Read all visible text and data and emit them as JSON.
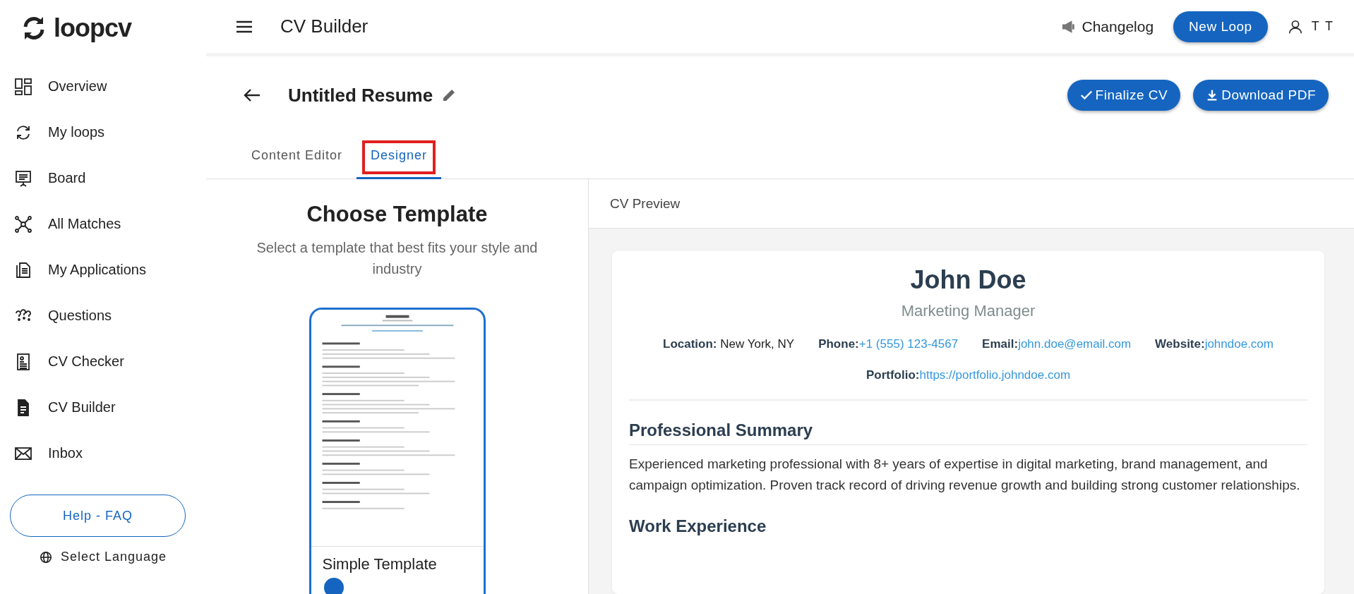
{
  "brand": {
    "name": "loopcv"
  },
  "sidebar": {
    "items": [
      {
        "label": "Overview",
        "selected": false
      },
      {
        "label": "My loops",
        "selected": false
      },
      {
        "label": "Board",
        "selected": false
      },
      {
        "label": "All Matches",
        "selected": false
      },
      {
        "label": "My Applications",
        "selected": false
      },
      {
        "label": "Questions",
        "selected": false
      },
      {
        "label": "CV Checker",
        "selected": false
      },
      {
        "label": "CV Builder",
        "selected": false
      },
      {
        "label": "Inbox",
        "selected": false
      }
    ],
    "help_button": "Help - FAQ",
    "language": "Select Language"
  },
  "topbar": {
    "title": "CV Builder",
    "changelog": "Changelog",
    "new_loop": "New Loop",
    "user": "T T"
  },
  "editor": {
    "title": "Untitled Resume",
    "actions": [
      "Finalize CV",
      "Download PDF"
    ],
    "tabs": [
      {
        "label": "Content Editor",
        "selected": false,
        "highlighted": false
      },
      {
        "label": "Designer",
        "selected": true,
        "highlighted": true
      }
    ]
  },
  "templates": {
    "heading": "Choose Template",
    "subtitle": "Select a template that best fits your style and industry",
    "cards": [
      {
        "name": "Simple Template",
        "selected": true
      }
    ]
  },
  "preview": {
    "header": "CV Preview",
    "name": "John Doe",
    "role": "Marketing Manager",
    "contacts": [
      {
        "label": "Location:",
        "value": "New York, NY",
        "link": false
      },
      {
        "label": "Phone:",
        "value": "+1 (555) 123-4567",
        "link": true
      },
      {
        "label": "Email:",
        "value": "john.doe@email.com",
        "link": true
      },
      {
        "label": "Website:",
        "value": "johndoe.com",
        "link": true
      },
      {
        "label": "Portfolio:",
        "value": "https://portfolio.johndoe.com",
        "link": true
      }
    ],
    "sections": [
      {
        "heading": "Professional Summary",
        "text": "Experienced marketing professional with 8+ years of expertise in digital marketing, brand management, and campaign optimization. Proven track record of driving revenue growth and building strong customer relationships."
      },
      {
        "heading": "Work Experience"
      }
    ]
  }
}
